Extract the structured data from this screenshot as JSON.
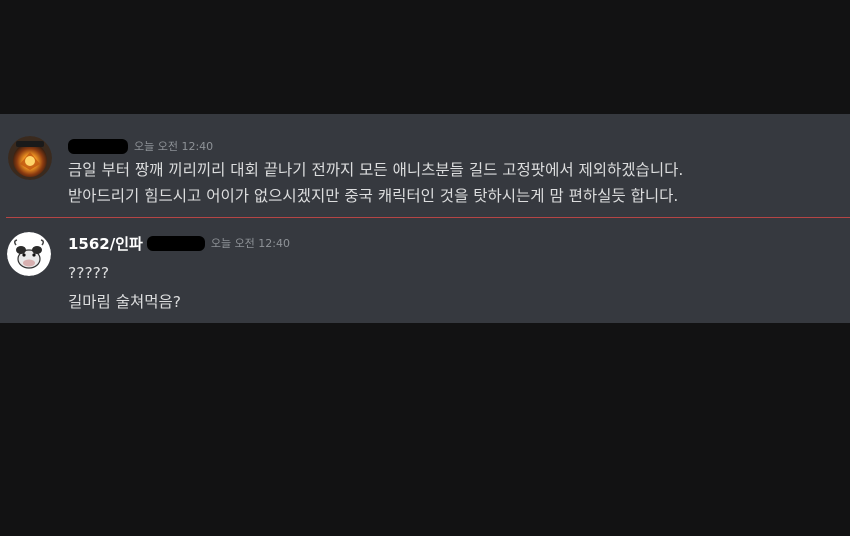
{
  "messages": [
    {
      "username": "",
      "timestamp": "오늘 오전 12:40",
      "avatar_icon": "fiery-emblem-avatar",
      "lines": [
        "금일 부터 짱깨 끼리끼리 대회 끝나기 전까지 모든 애니츠분들 길드 고정팟에서 제외하겠습니다.",
        "받아드리기 힘드시고  어이가 없으시겠지만 중국 캐릭터인 것을 탓하시는게 맘 편하실듯 합니다."
      ]
    },
    {
      "username": "1562/인파",
      "timestamp": "오늘 오전 12:40",
      "avatar_icon": "cow-avatar",
      "lines": [
        "?????",
        "길마림 술쳐먹음?"
      ]
    }
  ],
  "colors": {
    "background": "#121213",
    "panel": "#36393f",
    "text": "#dcddde",
    "username": "#ffffff",
    "timestamp": "#8e9297",
    "divider": "#b54545"
  }
}
